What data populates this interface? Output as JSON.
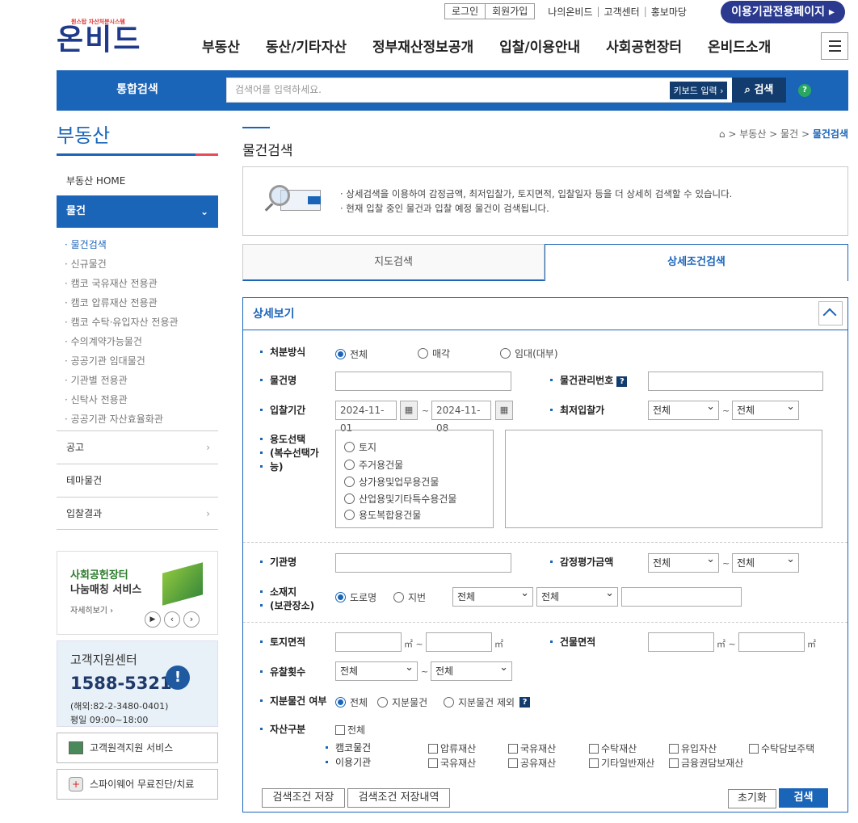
{
  "top": {
    "login": "로그인",
    "join": "회원가입",
    "my": "나의온비드",
    "cs": "고객센터",
    "pr": "홍보마당",
    "org_page": "이용기관전용페이지"
  },
  "logo": {
    "sub": "원스탑 자산처분시스템",
    "main": "온비드"
  },
  "gnb": [
    "부동산",
    "동산/기타자산",
    "정부재산정보공개",
    "입찰/이용안내",
    "사회공헌장터",
    "온비드소개"
  ],
  "search": {
    "label": "통합검색",
    "placeholder": "검색어를 입력하세요.",
    "keyboard": "키보드 입력",
    "button": "검색",
    "help": "?"
  },
  "lnb": {
    "title": "부동산",
    "home": "부동산 HOME",
    "active": "물건",
    "subs": [
      "물건검색",
      "신규물건",
      "캠코 국유재산 전용관",
      "캠코 압류재산 전용관",
      "캠코 수탁·유입자산 전용관",
      "수의계약가능물건",
      "공공기관 임대물건",
      "기관별 전용관",
      "신탁사 전용관",
      "공공기관 자산효율화관"
    ],
    "boxes": [
      "공고",
      "테마물건",
      "입찰결과"
    ]
  },
  "banner1": {
    "title1": "사회공헌장터",
    "title2": "나눔매칭 서비스",
    "more": "자세히보기"
  },
  "banner2": {
    "title": "고객지원센터",
    "phone": "1588-5321",
    "overseas": "(해외:82-2-3480-0401)",
    "hours": "평일 09:00~18:00"
  },
  "lbtns": [
    "고객원격지원 서비스",
    "스파이웨어 무료진단/치료"
  ],
  "content": {
    "title": "물건검색",
    "breadcrumb": [
      "부동산",
      "물건",
      "물건검색"
    ],
    "info": [
      "· 상세검색을 이용하여 감정금액, 최저입찰가, 토지면적, 입찰일자 등을 더 상세히 검색할 수 있습니다.",
      "· 현재 입찰 중인 물건과 입찰 예정 물건이 검색됩니다."
    ],
    "tabs": [
      "지도검색",
      "상세조건검색"
    ]
  },
  "form": {
    "panel_title": "상세보기",
    "disposal": {
      "label": "처분방식",
      "opts": [
        "전체",
        "매각",
        "임대(대부)"
      ]
    },
    "item_name": {
      "label": "물건명",
      "value": ""
    },
    "item_no": {
      "label": "물건관리번호",
      "value": ""
    },
    "bid_period": {
      "label": "입찰기간",
      "from": "2024-11-01",
      "to": "2024-11-08",
      "sep": "~"
    },
    "min_bid": {
      "label": "최저입찰가",
      "from": "전체",
      "to": "전체"
    },
    "usage": {
      "label1": "용도선택",
      "label2": "(복수선택가",
      "label3": "능)",
      "opts": [
        "토지",
        "주거용건물",
        "상가용및업무용건물",
        "산업용및기타특수용건물",
        "용도복합용건물"
      ]
    },
    "org": {
      "label": "기관명",
      "value": ""
    },
    "appraisal": {
      "label": "감정평가금액",
      "from": "전체",
      "to": "전체"
    },
    "location": {
      "label1": "소재지",
      "label2": "(보관장소)",
      "opts": [
        "도로명",
        "지번"
      ],
      "sel1": "전체",
      "sel2": "전체"
    },
    "land_area": {
      "label": "토지면적",
      "unit": "㎡"
    },
    "bldg_area": {
      "label": "건물면적",
      "unit": "㎡"
    },
    "fail_count": {
      "label": "유찰횟수",
      "from": "전체",
      "to": "전체"
    },
    "share": {
      "label": "지분물건 여부",
      "opts": [
        "전체",
        "지분물건",
        "지분물건 제외"
      ]
    },
    "asset": {
      "label": "자산구분",
      "all": "전체",
      "row1_label": "캠코물건",
      "row2_label": "이용기관",
      "row1": [
        "압류재산",
        "국유재산",
        "수탁재산",
        "유입자산",
        "수탁담보주택"
      ],
      "row2": [
        "국유재산",
        "공유재산",
        "기타일반재산",
        "금융권담보재산"
      ]
    },
    "buttons": {
      "save": "검색조건 저장",
      "history": "검색조건 저장내역",
      "reset": "초기화",
      "search": "검색"
    }
  }
}
